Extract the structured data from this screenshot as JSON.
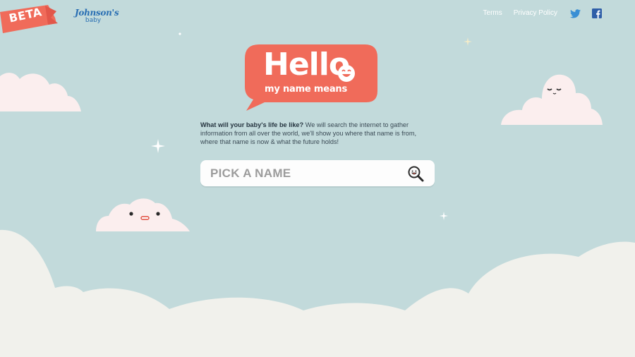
{
  "badge": {
    "label": "BETA",
    "color": "#f06b5a"
  },
  "brand": {
    "name": "Johnson's",
    "sub": "baby",
    "color": "#2a6fb3"
  },
  "nav": {
    "terms": "Terms",
    "privacy": "Privacy Policy",
    "twitter_icon": "twitter-icon",
    "facebook_icon": "facebook-icon"
  },
  "hero": {
    "title": "Hello",
    "subtitle": "my name means",
    "bubble_color": "#f06b5a"
  },
  "intro": {
    "question": "What will your baby's life be like?",
    "body": " We will search the internet to gather information from all over the world, we'll show you where that name is from, where that name is now & what the future holds!"
  },
  "search": {
    "placeholder": "PICK A NAME",
    "icon": "search-icon"
  },
  "colors": {
    "background": "#c2dadb",
    "cloud_pink": "#fbeeee",
    "cloud_ground": "#f1f1ec",
    "accent": "#f06b5a"
  }
}
